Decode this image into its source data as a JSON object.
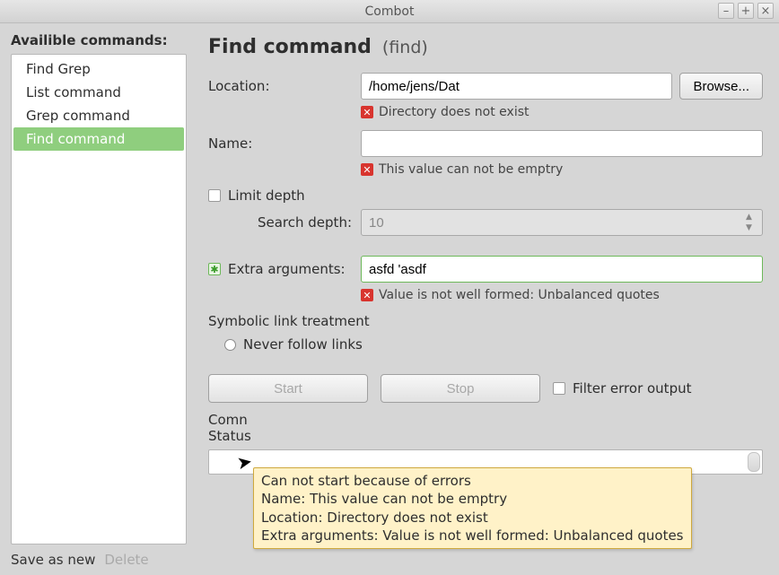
{
  "window": {
    "title": "Combot"
  },
  "sidebar": {
    "header": "Availible commands:",
    "items": [
      {
        "label": "Find Grep",
        "selected": false
      },
      {
        "label": "List command",
        "selected": false
      },
      {
        "label": "Grep command",
        "selected": false
      },
      {
        "label": "Find command",
        "selected": true
      }
    ],
    "save_as_new": "Save as new",
    "delete": "Delete"
  },
  "page": {
    "title": "Find command",
    "subtitle": "(find)"
  },
  "form": {
    "location_label": "Location:",
    "location_value": "/home/jens/Dat",
    "browse_label": "Browse...",
    "location_error": "Directory does not exist",
    "name_label": "Name:",
    "name_value": "",
    "name_error": "This value can not be emptry",
    "limit_depth_label": "Limit depth",
    "search_depth_label": "Search depth:",
    "search_depth_value": "10",
    "extra_label": "Extra arguments:",
    "extra_value": "asfd 'asdf",
    "extra_error": "Value is not well formed: Unbalanced quotes",
    "symlink_header": "Symbolic link treatment",
    "symlink_never": "Never follow links"
  },
  "actions": {
    "start": "Start",
    "stop": "Stop",
    "filter_error": "Filter error output"
  },
  "status": {
    "command_label": "Comn",
    "status_label": "Status"
  },
  "tooltip": {
    "line1": "Can not start because of errors",
    "line2": "Name: This value can not be emptry",
    "line3": "Location: Directory does not exist",
    "line4": "Extra arguments: Value is not well formed: Unbalanced quotes"
  }
}
